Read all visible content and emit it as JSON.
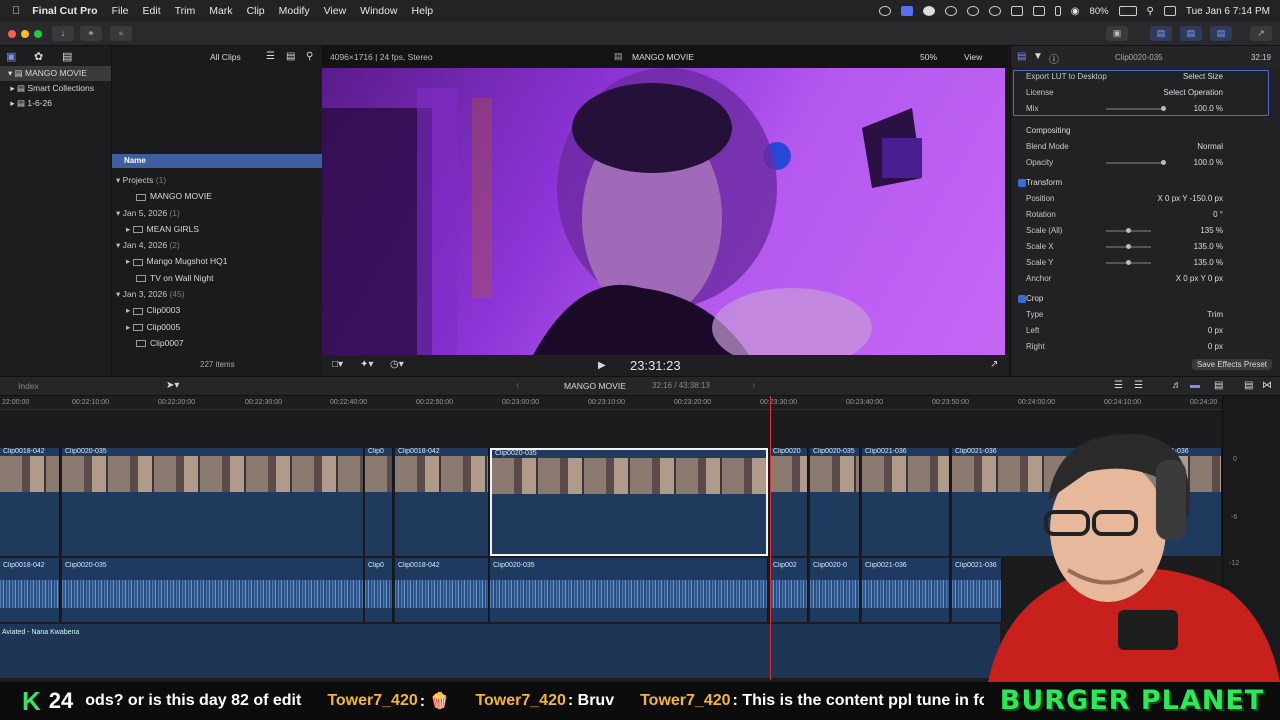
{
  "menubar": {
    "app": "Final Cut Pro",
    "items": [
      "File",
      "Edit",
      "Trim",
      "Mark",
      "Clip",
      "Modify",
      "View",
      "Window",
      "Help"
    ],
    "battery": "80%",
    "clock": "Tue Jan 6  7:14 PM"
  },
  "libraries": {
    "items": [
      "MANGO MOVIE",
      "Smart Collections",
      "1-6-26"
    ]
  },
  "browser": {
    "filter": "All Clips",
    "column": "Name",
    "item_count": "227 items",
    "groups": [
      {
        "label": "Projects",
        "count": "(1)",
        "items": [
          "MANGO MOVIE"
        ]
      },
      {
        "label": "Jan 5, 2026",
        "count": "(1)",
        "items": [
          "MEAN GIRLS"
        ]
      },
      {
        "label": "Jan 4, 2026",
        "count": "(2)",
        "items": [
          "Mango Mugshot HQ1",
          "TV on Wall Night"
        ]
      },
      {
        "label": "Jan 3, 2026",
        "count": "(45)",
        "items": [
          "Clip0003",
          "Clip0005",
          "Clip0007"
        ]
      }
    ]
  },
  "viewer": {
    "format": "4096×1716 | 24 fps, Stereo",
    "title": "MANGO MOVIE",
    "zoom": "50%",
    "view": "View",
    "timecode": "23:31:23"
  },
  "inspector": {
    "clip": "Clip0020-035",
    "duration": "32:19",
    "rows": [
      {
        "label": "Export LUT to Desktop",
        "value": "Select Size"
      },
      {
        "label": "License",
        "value": "Select Operation"
      },
      {
        "label": "Mix",
        "value": "100.0  %"
      },
      {
        "label": "Compositing",
        "value": ""
      },
      {
        "label": "Blend Mode",
        "value": "Normal"
      },
      {
        "label": "Opacity",
        "value": "100.0  %"
      },
      {
        "label": "Transform",
        "value": ""
      },
      {
        "label": "Position",
        "value": "X    0  px   Y  -150.0  px"
      },
      {
        "label": "Rotation",
        "value": "0  °"
      },
      {
        "label": "Scale (All)",
        "value": "135  %"
      },
      {
        "label": "Scale X",
        "value": "135.0  %"
      },
      {
        "label": "Scale Y",
        "value": "135.0  %"
      },
      {
        "label": "Anchor",
        "value": "X    0  px   Y    0  px"
      },
      {
        "label": "Crop",
        "value": ""
      },
      {
        "label": "Type",
        "value": "Trim"
      },
      {
        "label": "Left",
        "value": "0  px"
      },
      {
        "label": "Right",
        "value": "0  px"
      }
    ],
    "save_preset": "Save Effects Preset"
  },
  "timeline": {
    "index": "Index",
    "project": "MANGO MOVIE",
    "duration": "32:16 / 43:38:13",
    "ruler": [
      "22:00:00",
      "00:22:10:00",
      "00:22:20:00",
      "00:22:30:00",
      "00:22:40:00",
      "00:22:50:00",
      "00:23:00:00",
      "00:23:10:00",
      "00:23:20:00",
      "00:23:30:00",
      "00:23:40:00",
      "00:23:50:00",
      "00:24:00:00",
      "00:24:10:00",
      "00:24:20"
    ],
    "video_clips": [
      "Clip0018-042",
      "Clip0020-035",
      "Clip0",
      "Clip0018-042",
      "Clip0020-035",
      "Clip0020",
      "Clip0020-035",
      "Clip0021-036",
      "Clip0021-036",
      "Clip0021-036"
    ],
    "audio_clips": [
      "Clip0018-042",
      "Clip0020-035",
      "Clip0",
      "Clip0018-042",
      "Clip0020-035",
      "Clip002",
      "Clip0020-0",
      "Clip0021-036",
      "Clip0021-036"
    ],
    "music": "Aviated - Nana Kwabena",
    "meter": [
      "0",
      "-6",
      "-12"
    ]
  },
  "ticker": {
    "k": "K",
    "num": "24",
    "msg1": "ods? or is this day 82 of edit",
    "user1": "Tower7_420",
    "msg2": ": 🍿",
    "user2": "Tower7_420",
    "msg3": ": Bruv",
    "user3": "Tower7_420",
    "msg4": ": This is the content ppl tune in for?",
    "brand": "BURGER PLANET"
  }
}
